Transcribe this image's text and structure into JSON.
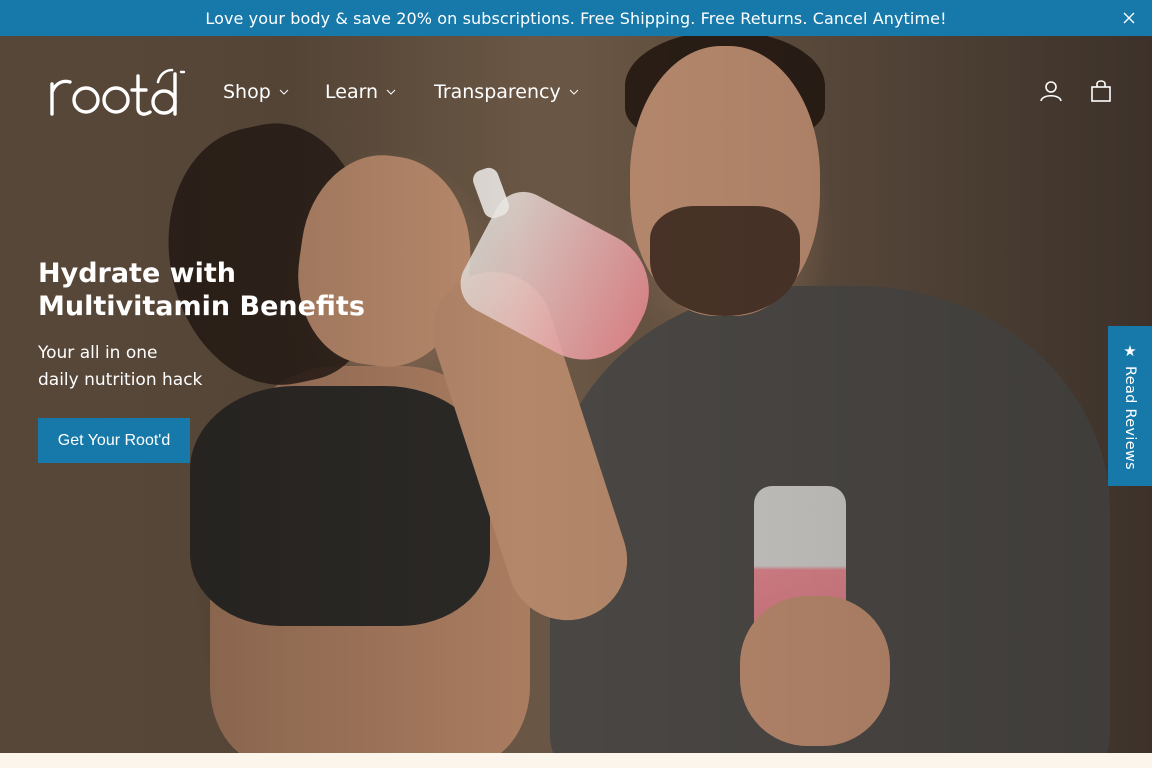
{
  "announcement": {
    "text": "Love your body & save 20% on subscriptions. Free Shipping. Free Returns. Cancel Anytime!",
    "close_icon": "close-icon"
  },
  "header": {
    "logo_text": "Root'd",
    "nav": [
      {
        "label": "Shop",
        "icon": "chevron-down-icon"
      },
      {
        "label": "Learn",
        "icon": "chevron-down-icon"
      },
      {
        "label": "Transparency",
        "icon": "chevron-down-icon"
      }
    ],
    "icons": [
      "user-icon",
      "shopping-bag-icon"
    ]
  },
  "hero": {
    "headline": "Hydrate with Multivitamin Benefits",
    "subline": "Your all in one\ndaily nutrition hack",
    "cta_label": "Get Your Root'd"
  },
  "reviews_tab": {
    "label": "Read Reviews",
    "icon": "star-icon"
  },
  "colors": {
    "brand_blue": "#1679a9",
    "text_light": "#ffffff",
    "page_bg": "#fbf5ec"
  }
}
